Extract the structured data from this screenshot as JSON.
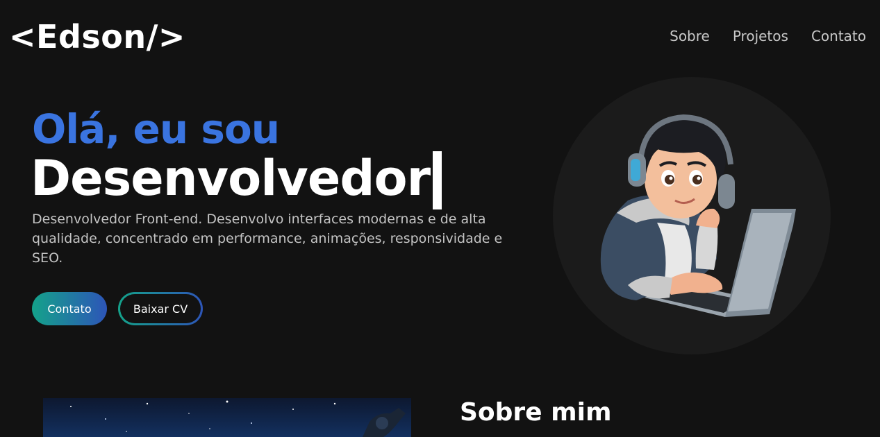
{
  "header": {
    "logo": "<Edson/>",
    "nav": [
      "Sobre",
      "Projetos",
      "Contato"
    ]
  },
  "hero": {
    "greeting": "Olá, eu sou",
    "role": "Desenvolvedor",
    "description": "Desenvolvedor Front-end. Desenvolvo interfaces modernas e de alta qualidade, concentrado em performance, animações, responsividade e SEO.",
    "contact_button": "Contato",
    "cv_button": "Baixar CV",
    "avatar_icon": "developer-avatar-illustration"
  },
  "about": {
    "title": "Sobre mim",
    "image_icon": "night-sky-telescope-image"
  },
  "colors": {
    "background": "#121212",
    "accent_blue": "#3a74e0",
    "gradient_start": "#14a28a",
    "gradient_end": "#2d55b8"
  }
}
